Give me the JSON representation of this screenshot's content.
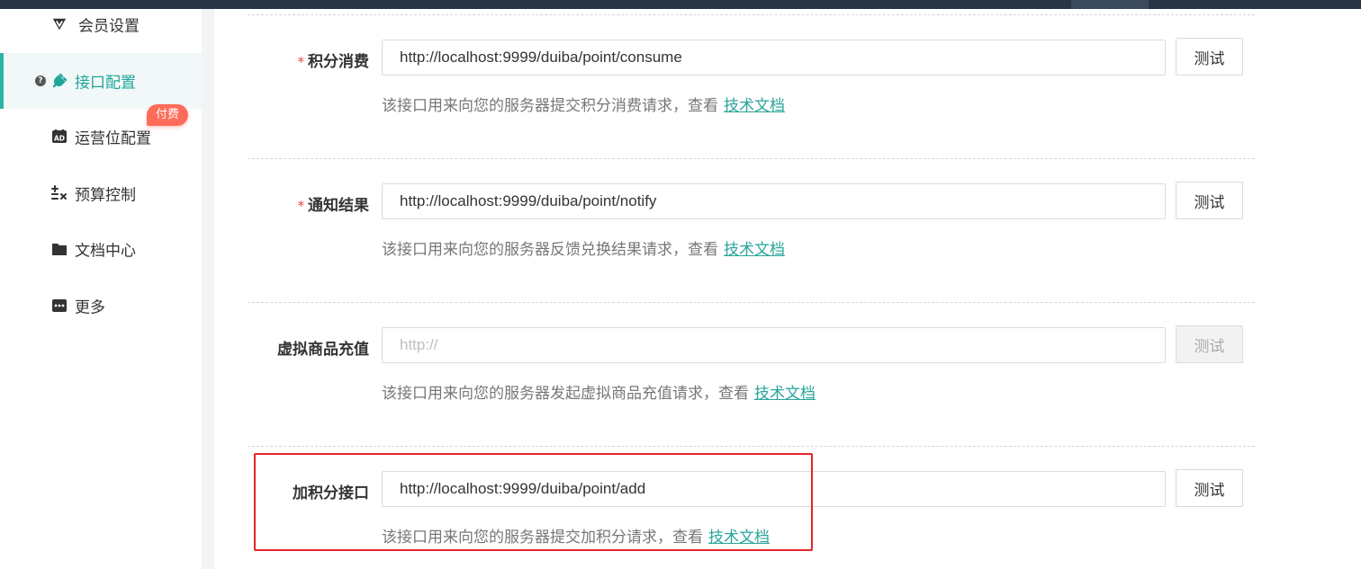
{
  "sidebar": {
    "items": [
      {
        "label": "会员设置",
        "icon": "vip-diamond-icon"
      },
      {
        "label": "接口配置",
        "icon": "plug-icon",
        "active": true
      },
      {
        "label": "运营位配置",
        "icon": "ad-icon"
      },
      {
        "label": "预算控制",
        "icon": "budget-calc-icon"
      },
      {
        "label": "文档中心",
        "icon": "folder-icon"
      },
      {
        "label": "更多",
        "icon": "more-icon"
      }
    ],
    "paid_badge": "付费",
    "help_mark": "?"
  },
  "form": {
    "test_label": "测试",
    "doc_link": "技术文档",
    "rows": [
      {
        "label": "积分消费",
        "required": true,
        "required_mark": "*",
        "value": "http://localhost:9999/duiba/point/consume",
        "placeholder": "",
        "desc": "该接口用来向您的服务器提交积分消费请求，查看"
      },
      {
        "label": "通知结果",
        "required": true,
        "required_mark": "*",
        "value": "http://localhost:9999/duiba/point/notify",
        "placeholder": "",
        "desc": "该接口用来向您的服务器反馈兑换结果请求，查看"
      },
      {
        "label": "虚拟商品充值",
        "required": false,
        "value": "",
        "placeholder": "http://",
        "test_disabled": true,
        "desc": "该接口用来向您的服务器发起虚拟商品充值请求，查看"
      },
      {
        "label": "加积分接口",
        "required": false,
        "value": "http://localhost:9999/duiba/point/add",
        "placeholder": "",
        "desc": "该接口用来向您的服务器提交加积分请求，查看"
      }
    ]
  },
  "colors": {
    "accent": "#2aa59b",
    "required": "#f04545",
    "badge": "#ff6b5a",
    "highlight": "#e6232a",
    "topbar": "#283544"
  }
}
